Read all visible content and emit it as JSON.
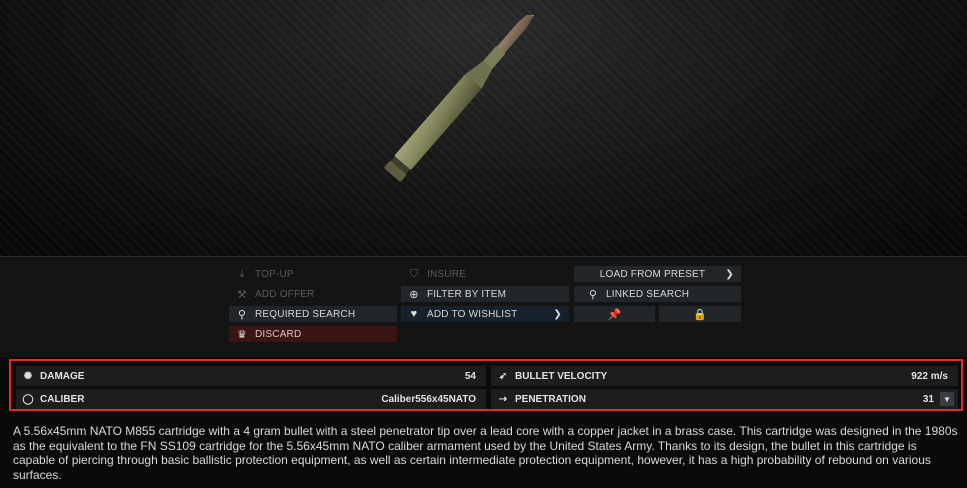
{
  "actions": {
    "top_up": "TOP-UP",
    "add_offer": "ADD OFFER",
    "required_search": "REQUIRED SEARCH",
    "discard": "DISCARD",
    "insure": "INSURE",
    "filter_by_item": "FILTER BY ITEM",
    "add_to_wishlist": "ADD TO WISHLIST",
    "load_from_preset": "LOAD FROM PRESET",
    "linked_search": "LINKED SEARCH"
  },
  "stats": {
    "damage_label": "DAMAGE",
    "damage_value": "54",
    "caliber_label": "CALIBER",
    "caliber_value": "Caliber556x45NATO",
    "velocity_label": "BULLET VELOCITY",
    "velocity_value": "922 m/s",
    "penetration_label": "PENETRATION",
    "penetration_value": "31"
  },
  "description": "A 5.56x45mm NATO M855 cartridge with a 4 gram bullet with a steel penetrator tip over a lead core with a copper jacket in a brass case. This cartridge was designed in the 1980s as the equivalent to the FN SS109 cartridge for the 5.56x45mm NATO caliber armament used by the United States Army. Thanks to its design, the bullet in this cartridge is capable of piercing through basic ballistic protection equipment, as well as certain intermediate protection equipment, however, it has a high probability of rebound on various surfaces.",
  "colors": {
    "highlight_border": "#e52a24",
    "tip_green": "#4fd24a",
    "discard_bg": "#3a1515"
  },
  "icons": {
    "top_up": "download-arrow-icon",
    "add_offer": "hammer-icon",
    "required_search": "nodes-icon",
    "discard": "crown-icon",
    "insure": "shield-icon",
    "filter_by_item": "magnifier-icon",
    "add_to_wishlist": "heart-icon",
    "linked_search": "nodes-icon",
    "pin": "pin-icon",
    "lock": "lock-icon"
  }
}
